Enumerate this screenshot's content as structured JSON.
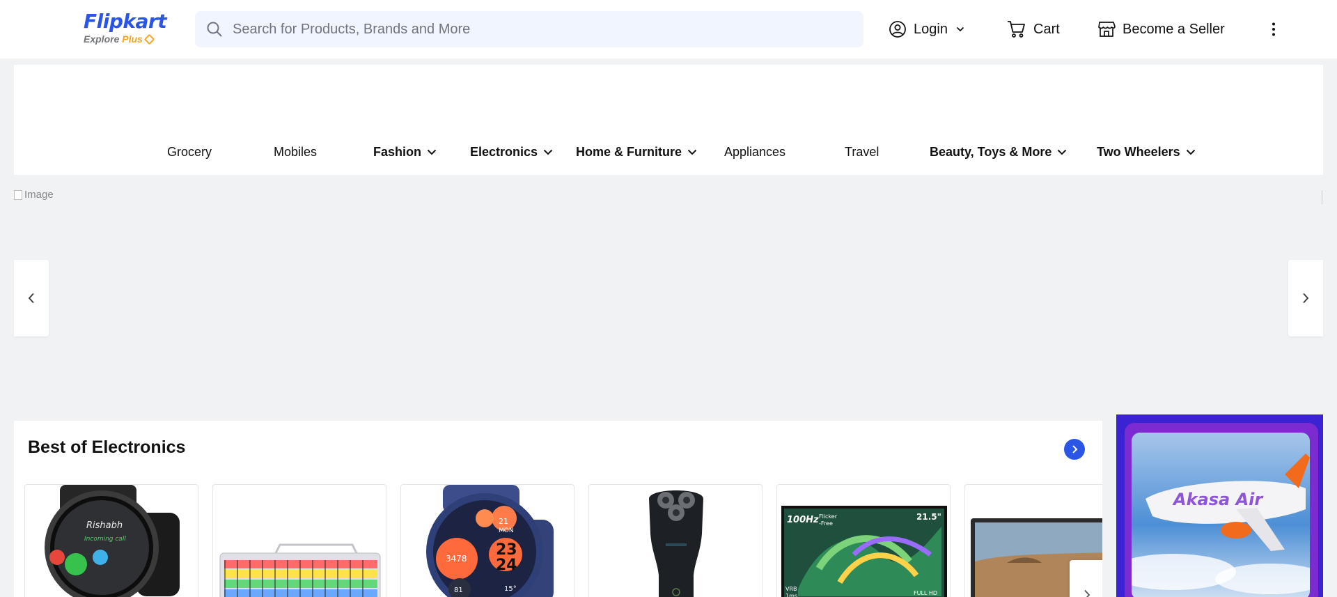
{
  "header": {
    "logo": {
      "name": "Flipkart",
      "tagline_prefix": "Explore",
      "tagline_plus": "Plus"
    },
    "search": {
      "placeholder": "Search for Products, Brands and More",
      "value": ""
    },
    "login_label": "Login",
    "cart_label": "Cart",
    "seller_label": "Become a Seller"
  },
  "categories": [
    {
      "label": "Grocery",
      "dropdown": false
    },
    {
      "label": "Mobiles",
      "dropdown": false
    },
    {
      "label": "Fashion",
      "dropdown": true
    },
    {
      "label": "Electronics",
      "dropdown": true
    },
    {
      "label": "Home & Furniture",
      "dropdown": true
    },
    {
      "label": "Appliances",
      "dropdown": false
    },
    {
      "label": "Travel",
      "dropdown": false
    },
    {
      "label": "Beauty, Toys & More",
      "dropdown": true
    },
    {
      "label": "Two Wheelers",
      "dropdown": true
    }
  ],
  "banner": {
    "image_alt": "Image"
  },
  "section": {
    "title": "Best of Electronics",
    "products": [
      {
        "icon": "smartwatch-icon",
        "watch_name": "Rishabh",
        "watch_status": "Incoming call"
      },
      {
        "icon": "keyboard-icon"
      },
      {
        "icon": "smartwatch-blue-icon",
        "watch_nums": [
          "3478",
          "21",
          "MON",
          "23",
          "24",
          "81",
          "15°"
        ]
      },
      {
        "icon": "shaver-icon"
      },
      {
        "icon": "monitor-icon",
        "monitor_texts": [
          "100Hz",
          "Flicker",
          "-Free",
          "21.5\"",
          "VRB",
          "1ms",
          "FULL HD"
        ]
      },
      {
        "icon": "laptop-icon"
      }
    ]
  },
  "ad": {
    "brand": "Akasa Air"
  },
  "colors": {
    "accent": "#2a55e5",
    "page_bg": "#f1f2f4",
    "search_bg": "#f0f5ff"
  }
}
